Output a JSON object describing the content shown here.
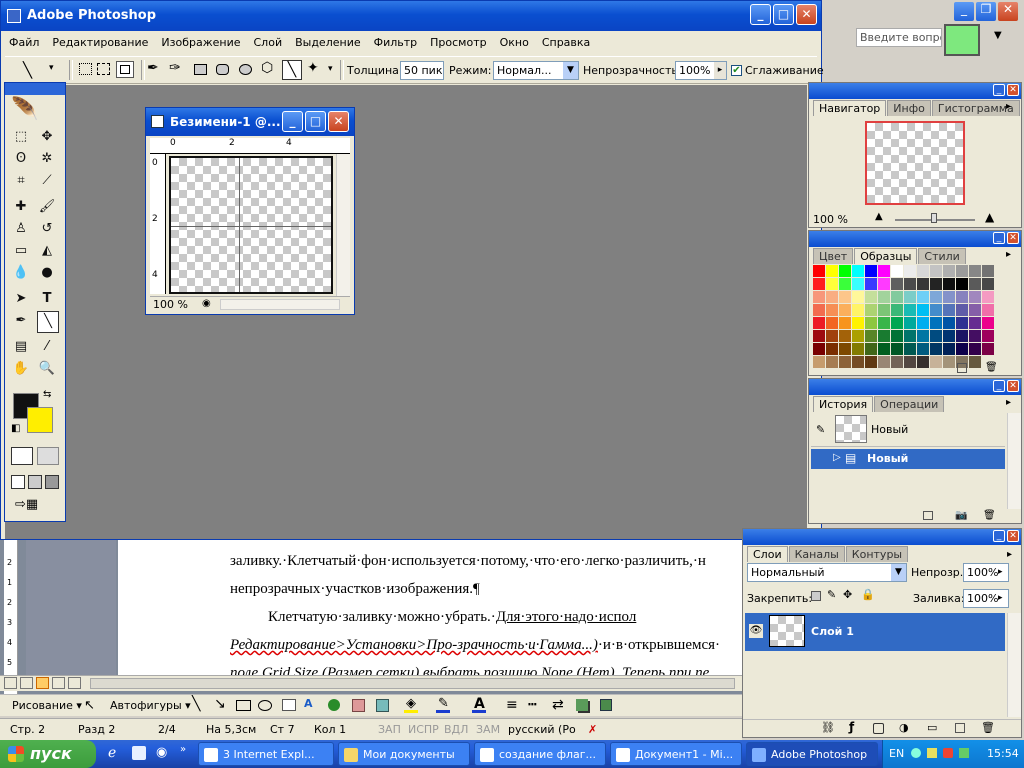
{
  "photoshop": {
    "title": "Adobe Photoshop",
    "menu": [
      "Файл",
      "Редактирование",
      "Изображение",
      "Слой",
      "Выделение",
      "Фильтр",
      "Просмотр",
      "Окно",
      "Справка"
    ],
    "options": {
      "thickness_label": "Толщина:",
      "thickness_value": "50 пик",
      "mode_label": "Режим:",
      "mode_value": "Нормал...",
      "opacity_label": "Непрозрачность:",
      "opacity_value": "100%",
      "antialias_label": "Сглаживание"
    },
    "document": {
      "title": "Безимени-1 @...",
      "zoom": "100 %",
      "ruler_top": [
        "0",
        "2",
        "4"
      ],
      "ruler_left": [
        "0",
        "2",
        "4"
      ]
    }
  },
  "help_search": {
    "placeholder": "Введите вопрос"
  },
  "navigator": {
    "tabs": [
      "Навигатор",
      "Инфо",
      "Гистограмма"
    ],
    "zoom": "100 %"
  },
  "swatches": {
    "tabs": [
      "Цвет",
      "Образцы",
      "Стили"
    ],
    "colors": [
      [
        "#ff0000",
        "#ffff00",
        "#00ff00",
        "#00ffff",
        "#0000ff",
        "#ff00ff",
        "#ffffff",
        "#ebebeb",
        "#d7d7d7",
        "#c3c3c3",
        "#afafaf",
        "#9b9b9b",
        "#878787",
        "#737373"
      ],
      [
        "#ff1f1f",
        "#ffff3a",
        "#3aff3a",
        "#3affff",
        "#3a3aff",
        "#ff3aff",
        "#5f5f5f",
        "#4b4b4b",
        "#373737",
        "#232323",
        "#0f0f0f",
        "#000000",
        "#5a5a5a",
        "#484848"
      ],
      [
        "#f7977a",
        "#f9ad81",
        "#fdc68a",
        "#fff79a",
        "#c4df9b",
        "#a2d39c",
        "#82ca9d",
        "#7bcdc8",
        "#6ecff6",
        "#7ea7d8",
        "#8493ca",
        "#8882be",
        "#a187be",
        "#f49ac2"
      ],
      [
        "#f26c4f",
        "#f68e55",
        "#fbaf5c",
        "#fff467",
        "#acd372",
        "#7cc576",
        "#3bb878",
        "#1abbb4",
        "#00bff3",
        "#438ccb",
        "#5574b9",
        "#605ca8",
        "#855fa8",
        "#f06ea9"
      ],
      [
        "#ed1c24",
        "#f26522",
        "#f7941d",
        "#fff200",
        "#8dc73f",
        "#39b54a",
        "#00a651",
        "#00a99d",
        "#00aeef",
        "#0072bc",
        "#0054a6",
        "#2e3192",
        "#662d91",
        "#ec008c"
      ],
      [
        "#9e0b0f",
        "#a0410d",
        "#a36209",
        "#aba000",
        "#598527",
        "#197b30",
        "#007236",
        "#00746b",
        "#0076a3",
        "#004b80",
        "#003471",
        "#1b1464",
        "#440e62",
        "#9e005d"
      ],
      [
        "#790000",
        "#7b2e00",
        "#7d4900",
        "#827b00",
        "#406618",
        "#005e20",
        "#005826",
        "#005952",
        "#005b7f",
        "#003663",
        "#002157",
        "#0d004c",
        "#32004b",
        "#7b0046"
      ],
      [
        "#c69c6d",
        "#a67c52",
        "#8c6239",
        "#754c24",
        "#603913",
        "#998675",
        "#736357",
        "#534741",
        "#362f2d",
        "#c7b299",
        "#a39379",
        "#827560",
        "#66593f",
        ""
      ]
    ]
  },
  "history": {
    "tabs": [
      "История",
      "Операции"
    ],
    "snapshot_label": "Новый",
    "items": [
      "Новый"
    ]
  },
  "layers": {
    "tabs": [
      "Слои",
      "Каналы",
      "Контуры"
    ],
    "blend_mode": "Нормальный",
    "opacity_label": "Непрозр.:",
    "opacity_value": "100%",
    "lock_label": "Закрепить:",
    "fill_label": "Заливка:",
    "fill_value": "100%",
    "layer_name": "Слой 1"
  },
  "word": {
    "line1": "заливку.·Клетчатый·фон·используется·потому,·что·его·легко·различить,·н",
    "line2": "непрозрачных·участков·изображения.¶",
    "line3a": "Клетчатую·заливку·можно·убрать.·",
    "line3b": "Для·этого·надо·испол",
    "line4a": "Редактирование>Установки>Про-зрачность·и·Гамма...)",
    "line4b": "·и·в·открывшемся·",
    "line5": "поле Grid Size (Размер сетки) выбрать позицию None (Нет). Теперь при пе",
    "ruler_marks": [
      "2",
      "1",
      "1",
      "2",
      "3",
      "4",
      "5"
    ],
    "drawing": {
      "draw_label": "Рисование ▾",
      "autoshapes_label": "Автофигуры ▾"
    },
    "status": {
      "page": "Стр. 2",
      "section": "Разд 2",
      "pages": "2/4",
      "at": "На 5,3см",
      "line": "Ст 7",
      "col": "Кол 1",
      "rec": "ЗАП",
      "trk": "ИСПР",
      "ext": "ВДЛ",
      "ovr": "ЗАМ",
      "lang": "русский (Ро"
    }
  },
  "taskbar": {
    "start": "пуск",
    "buttons": [
      "3 Internet Expl...",
      "Мои документы",
      "создание флаг...",
      "Документ1 - Mi...",
      "Adobe Photoshop"
    ],
    "lang": "EN",
    "clock": "15:54"
  },
  "colors": {
    "xp_blue": "#0a4fd0",
    "canvas_gray": "#808080",
    "layer_selected": "#316ac5",
    "start_green": "#3c9c3c",
    "foreground": "#111111",
    "background": "#ffee00"
  }
}
